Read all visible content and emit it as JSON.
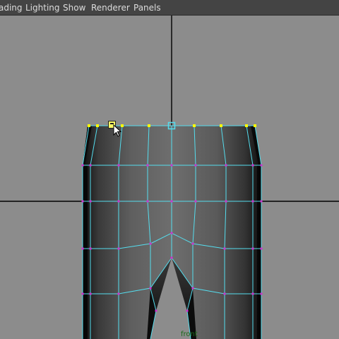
{
  "menu": {
    "items": [
      {
        "id": "shading",
        "label": "ading"
      },
      {
        "id": "lighting",
        "label": "Lighting"
      },
      {
        "id": "show",
        "label": "Show"
      },
      {
        "id": "renderer",
        "label": "Renderer"
      },
      {
        "id": "panels",
        "label": "Panels"
      }
    ]
  },
  "viewport": {
    "camera_label": "front",
    "colors": {
      "background": "#8c8c8c",
      "axis": "#000000",
      "wireframe": "#55ddee",
      "vertex": "#cc33cc",
      "selected_vertex": "#ffff00",
      "mesh_dark": "#1a1a1a",
      "mesh_light": "#8a8a8a"
    },
    "icons": [
      "move-tool-cursor-icon",
      "selection-handle-icon"
    ]
  }
}
